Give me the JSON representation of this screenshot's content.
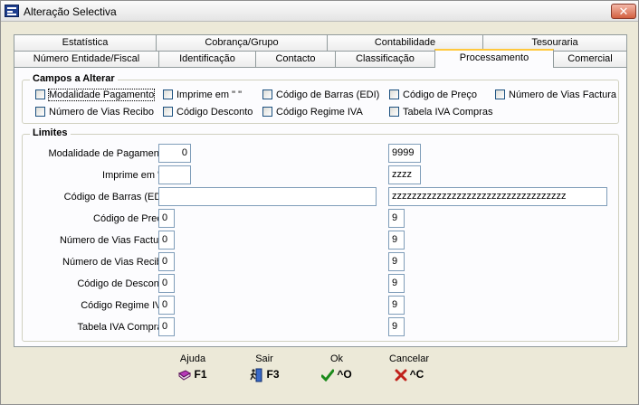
{
  "window": {
    "title": "Alteração Selectiva",
    "close_glyph": "✕",
    "app_icon": "app-icon"
  },
  "tabs": {
    "top_row": [
      "Estatística",
      "Cobrança/Grupo",
      "Contabilidade",
      "Tesouraria"
    ],
    "bottom_row": [
      "Número Entidade/Fiscal",
      "Identificação",
      "Contacto",
      "Classificação",
      "Processamento",
      "Comercial"
    ],
    "active": "Processamento"
  },
  "campos": {
    "title": "Campos a Alterar",
    "items": [
      {
        "label": "Modalidade Pagamento",
        "checked": false,
        "focused": true
      },
      {
        "label": "Imprime em \"   \"",
        "checked": false
      },
      {
        "label": "Código de Barras (EDI)",
        "checked": false
      },
      {
        "label": "Código de Preço",
        "checked": false
      },
      {
        "label": "Número de Vias Factura",
        "checked": false
      },
      {
        "label": "Número de Vias Recibo",
        "checked": false
      },
      {
        "label": "Código Desconto",
        "checked": false
      },
      {
        "label": "Código Regime IVA",
        "checked": false
      },
      {
        "label": "Tabela IVA Compras",
        "checked": false
      }
    ]
  },
  "limites": {
    "title": "Limites",
    "rows": [
      {
        "label": "Modalidade de Pagamento",
        "from": "0",
        "to": "9999"
      },
      {
        "label": "Imprime em \"   \"",
        "from": "",
        "to": "zzzz"
      },
      {
        "label": "Código de Barras (EDI)",
        "from": "",
        "to": "zzzzzzzzzzzzzzzzzzzzzzzzzzzzzzzzzzz"
      },
      {
        "label": "Código de Preço",
        "from": "0",
        "to": "9"
      },
      {
        "label": "Número de Vias Factura",
        "from": "0",
        "to": "9"
      },
      {
        "label": "Número de Vias Recibo",
        "from": "0",
        "to": "9"
      },
      {
        "label": "Código de Desconto",
        "from": "0",
        "to": "9"
      },
      {
        "label": "Código Regime IVA",
        "from": "0",
        "to": "9"
      },
      {
        "label": "Tabela IVA Compras",
        "from": "0",
        "to": "9"
      }
    ]
  },
  "buttons": [
    {
      "caption": "Ajuda",
      "key": "F1",
      "icon": "book-icon",
      "color": "#8a2b8a"
    },
    {
      "caption": "Sair",
      "key": "F3",
      "icon": "exit-door-icon",
      "color": "#1f3f8f"
    },
    {
      "caption": "Ok",
      "key": "^O",
      "icon": "checkmark-icon",
      "color": "#1a8a1a"
    },
    {
      "caption": "Cancelar",
      "key": "^C",
      "icon": "cross-icon",
      "color": "#c0201a"
    }
  ]
}
